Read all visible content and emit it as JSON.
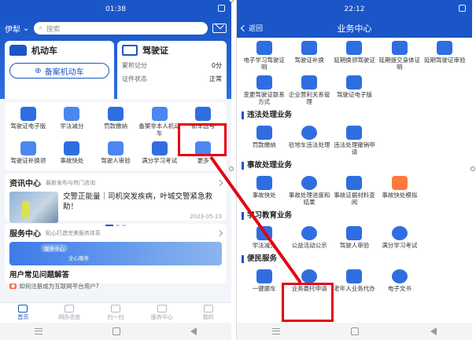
{
  "left": {
    "status_time": "01:38",
    "city": "伊犁",
    "search_placeholder": "搜索",
    "vehicle_card": {
      "title": "机动车",
      "button": "备案机动车"
    },
    "license_card": {
      "title": "驾驶证",
      "score_label": "累积记分",
      "score_value": "0分",
      "status_label": "证件状态",
      "status_value": "正常"
    },
    "grid_items": [
      "驾驶证电子版",
      "学法减分",
      "罚款缴纳",
      "备案非本人机动车",
      "新车选号",
      "驾驶证补换领",
      "事故快处",
      "驾驶人审验",
      "满分学习考试",
      "更多"
    ],
    "news": {
      "title": "资讯中心",
      "subtitle": "最新发布与热门咨询",
      "headline": "交警正能量｜司机突发疾病，叶城交警紧急救助！",
      "date": "2023-05-23"
    },
    "service": {
      "title": "服务中心",
      "subtitle": "贴心打造完美服务体系",
      "banner_tag": "服务中心",
      "banner_text": "全心服务",
      "faq_title": "用户常见问题解答",
      "faq_item": "如何注册成为互联网平台用户?"
    },
    "tabs": [
      "首页",
      "网办进度",
      "扫一扫",
      "服务中心",
      "我的"
    ]
  },
  "right": {
    "status_time": "22:12",
    "back_label": "返回",
    "title": "业务中心",
    "top_items": [
      "电子学习驾驶证明",
      "驾驶证补换",
      "延期换领驾驶证",
      "延期提交身体证明",
      "延期驾驶证审验",
      "变更驾驶证联系方式",
      "企业营利关系管理",
      "驾驶证电子版"
    ],
    "sections": [
      {
        "title": "违法处理业务",
        "items": [
          "罚款缴纳",
          "驻地车违法处理",
          "违法处理撤销申请"
        ]
      },
      {
        "title": "事故处理业务",
        "items": [
          "事故快处",
          "事故处理进度和结果",
          "事故证据材料查阅",
          "事故快处模拟"
        ]
      },
      {
        "title": "学习教育业务",
        "items": [
          "学法减分",
          "公益活动公示",
          "驾驶人审验",
          "满分学习考试"
        ]
      },
      {
        "title": "便民服务",
        "items": [
          "一键挪车",
          "业务委托申请",
          "老年人业务代办",
          "电子文书"
        ]
      }
    ]
  },
  "colors": {
    "brand": "#1a56c8",
    "highlight": "#e60012"
  }
}
